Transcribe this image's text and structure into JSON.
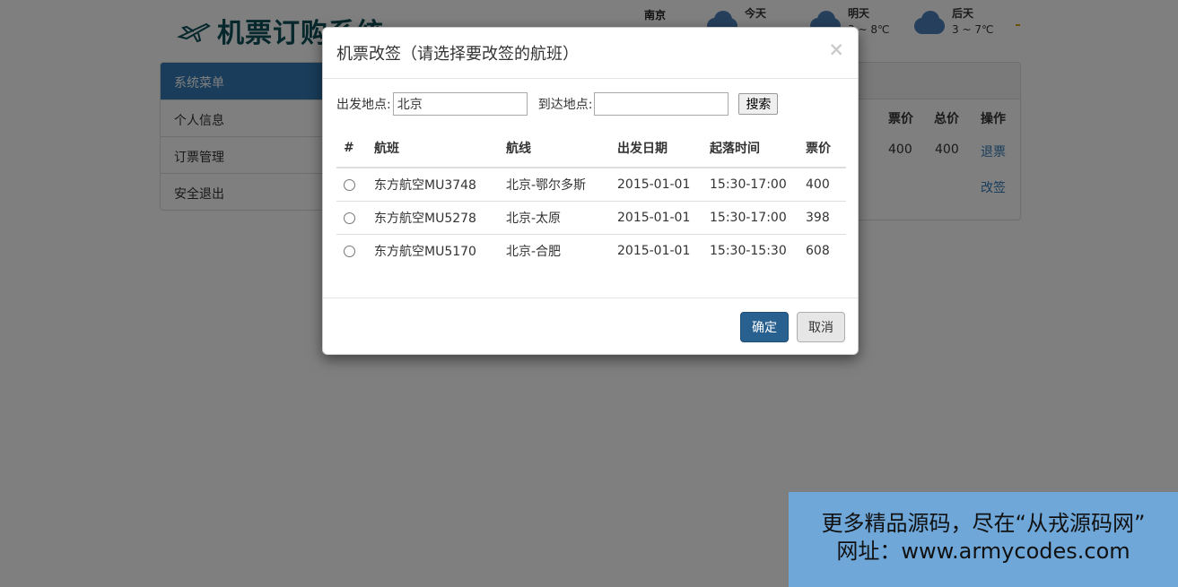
{
  "header": {
    "app_title": "机票订购系统",
    "weather": {
      "city": "南京",
      "days": [
        {
          "label": "今天",
          "temp": ""
        },
        {
          "label": "明天",
          "temp": "3 ~ 8℃"
        },
        {
          "label": "后天",
          "temp": "3 ~ 7℃"
        }
      ]
    }
  },
  "sidebar": {
    "title": "系统菜单",
    "items": [
      {
        "label": "个人信息"
      },
      {
        "label": "订票管理"
      },
      {
        "label": "安全退出"
      }
    ]
  },
  "order_table": {
    "headers": [
      "票价",
      "总价",
      "操作"
    ],
    "row": {
      "price": "400",
      "total": "400",
      "refund_link": "退票",
      "change_link": "改签"
    }
  },
  "modal": {
    "title": "机票改签（请选择要改签的航班）",
    "close": "×",
    "search": {
      "from_label": "出发地点:",
      "from_value": "北京",
      "to_label": "到达地点:",
      "to_value": "",
      "button": "搜索"
    },
    "table": {
      "headers": [
        "#",
        "航班",
        "航线",
        "出发日期",
        "起落时间",
        "票价"
      ],
      "rows": [
        {
          "flight": "东方航空MU3748",
          "route": "北京-鄂尔多斯",
          "date": "2015-01-01",
          "time": "15:30-17:00",
          "price": "400"
        },
        {
          "flight": "东方航空MU5278",
          "route": "北京-太原",
          "date": "2015-01-01",
          "time": "15:30-17:00",
          "price": "398"
        },
        {
          "flight": "东方航空MU5170",
          "route": "北京-合肥",
          "date": "2015-01-01",
          "time": "15:30-15:30",
          "price": "608"
        }
      ]
    },
    "confirm_button": "确定",
    "cancel_button": "取消"
  },
  "ad_banner": {
    "line1": "更多精品源码，尽在“从戎源码网”",
    "line2": "网址：www.armycodes.com"
  }
}
